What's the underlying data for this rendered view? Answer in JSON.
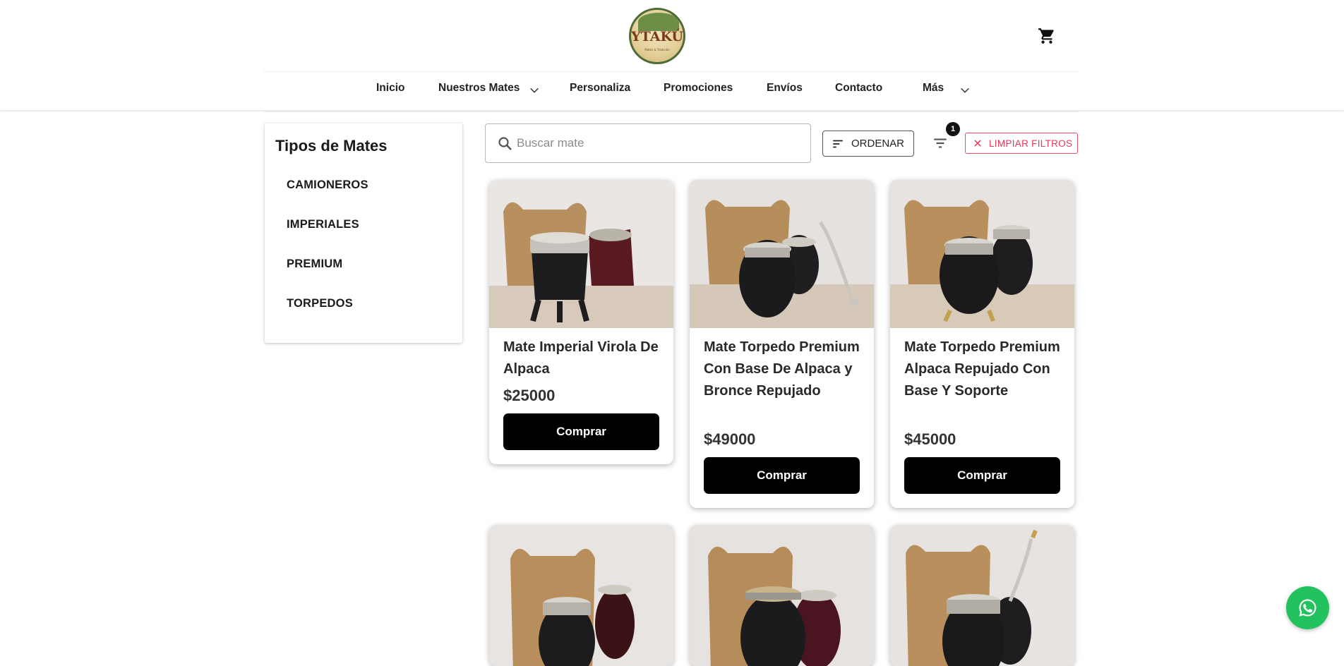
{
  "header": {
    "logo": {
      "text": "YTAKÚ",
      "tagline": "Mates & Tradición"
    },
    "cart_icon": "cart-icon"
  },
  "nav": {
    "items": [
      {
        "label": "Inicio"
      },
      {
        "label": "Nuestros Mates",
        "dropdown": true
      },
      {
        "label": "Personaliza"
      },
      {
        "label": "Promociones"
      },
      {
        "label": "Envíos"
      },
      {
        "label": "Contacto"
      },
      {
        "label": "Más",
        "dropdown": true
      }
    ]
  },
  "sidebar": {
    "title": "Tipos de Mates",
    "items": [
      {
        "label": "CAMIONEROS"
      },
      {
        "label": "IMPERIALES"
      },
      {
        "label": "PREMIUM"
      },
      {
        "label": "TORPEDOS"
      }
    ]
  },
  "toolbar": {
    "search_placeholder": "Buscar mate",
    "order_label": "ORDENAR",
    "filter_badge": "1",
    "clear_label": "LIMPIAR FILTROS"
  },
  "products": [
    {
      "title": "Mate Imperial Virola De Alpaca",
      "price": "$25000",
      "buy_label": "Comprar"
    },
    {
      "title": "Mate Torpedo Premium Con Base De Alpaca y Bronce Repujado",
      "price": "$49000",
      "buy_label": "Comprar"
    },
    {
      "title": "Mate Torpedo Premium Alpaca Repujado Con Base Y Soporte",
      "price": "$45000",
      "buy_label": "Comprar"
    },
    {
      "title": "",
      "price": "",
      "buy_label": ""
    },
    {
      "title": "",
      "price": "",
      "buy_label": ""
    },
    {
      "title": "",
      "price": "",
      "buy_label": ""
    }
  ],
  "colors": {
    "accent_clear": "#e6395a",
    "whatsapp": "#22c35e",
    "buy_button": "#000000"
  },
  "floating": {
    "whatsapp_icon": "whatsapp-icon"
  }
}
